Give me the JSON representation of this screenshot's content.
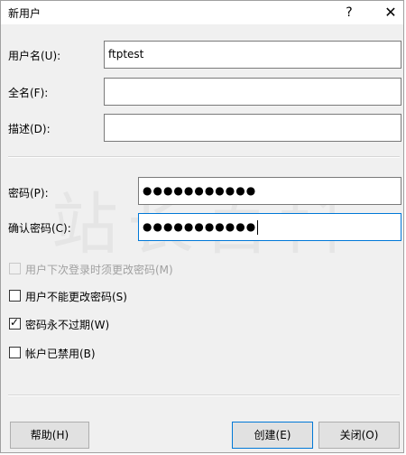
{
  "window": {
    "title": "新用户",
    "help_glyph": "?",
    "close_glyph": "✕"
  },
  "form": {
    "username_label": "用户名(U):",
    "username_value": "ftptest",
    "fullname_label": "全名(F):",
    "fullname_value": "",
    "description_label": "描述(D):",
    "description_value": "",
    "password_label": "密码(P):",
    "password_mask": "●●●●●●●●●●●",
    "confirm_label": "确认密码(C):",
    "confirm_mask": "●●●●●●●●●●●"
  },
  "options": [
    {
      "label": "用户下次登录时须更改密码(M)",
      "checked": false,
      "disabled": true
    },
    {
      "label": "用户不能更改密码(S)",
      "checked": false,
      "disabled": false
    },
    {
      "label": "密码永不过期(W)",
      "checked": true,
      "disabled": false
    },
    {
      "label": "帐户已禁用(B)",
      "checked": false,
      "disabled": false
    }
  ],
  "check_glyph": "✓",
  "buttons": {
    "help": "帮助(H)",
    "create": "创建(E)",
    "close": "关闭(O)"
  }
}
